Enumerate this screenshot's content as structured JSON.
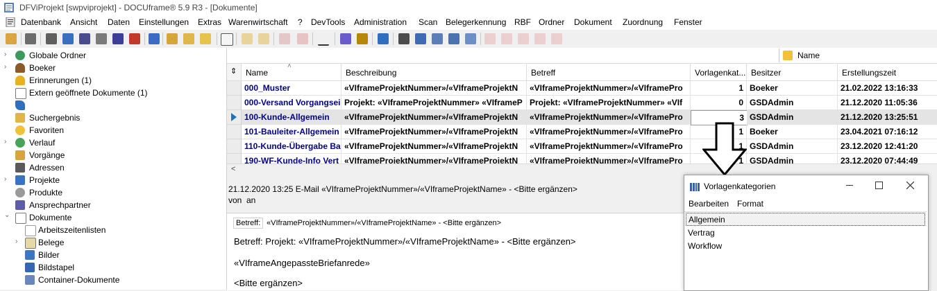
{
  "window": {
    "title": "DFViProjekt [swpviprojekt] - DOCUframe® 5.9 R3 - [Dokumente]"
  },
  "menu": [
    "Datenbank",
    "Ansicht",
    "Daten",
    "Einstellungen",
    "Extras",
    "Warenwirtschaft",
    "?",
    "DevTools",
    "Administration",
    "Scan",
    "Belegerkennung",
    "RBF",
    "Ordner",
    "Dokument",
    "Zuordnung",
    "Fenster"
  ],
  "tree": [
    {
      "label": "Globale Ordner",
      "icon": "globe-icon",
      "expandable": true
    },
    {
      "label": "Boeker",
      "icon": "user-icon",
      "expandable": true
    },
    {
      "label": "Erinnerungen (1)",
      "icon": "bell-icon",
      "expandable": false
    },
    {
      "label": "Extern geöffnete Dokumente (1)",
      "icon": "document-icon",
      "expandable": false
    },
    {
      "label": "",
      "icon": "pin-icon",
      "expandable": false
    },
    {
      "label": "Suchergebnis",
      "icon": "search-folder-icon",
      "expandable": false
    },
    {
      "label": "Favoriten",
      "icon": "star-icon",
      "expandable": false
    },
    {
      "label": "Verlauf",
      "icon": "history-icon",
      "expandable": true
    },
    {
      "label": "Vorgänge",
      "icon": "folder-icon",
      "expandable": false
    },
    {
      "label": "Adressen",
      "icon": "address-book-icon",
      "expandable": false
    },
    {
      "label": "Projekte",
      "icon": "project-icon",
      "expandable": true
    },
    {
      "label": "Produkte",
      "icon": "product-icon",
      "expandable": false
    },
    {
      "label": "Ansprechpartner",
      "icon": "contacts-icon",
      "expandable": false
    },
    {
      "label": "Dokumente",
      "icon": "document-icon",
      "expandable": true,
      "expanded": true
    },
    {
      "label": "Arbeitszeitenlisten",
      "icon": "document-icon",
      "expandable": false,
      "child": true
    },
    {
      "label": "Belege",
      "icon": "receipt-icon",
      "expandable": true,
      "child": true
    },
    {
      "label": "Bilder",
      "icon": "image-icon",
      "expandable": false,
      "child": true
    },
    {
      "label": "Bildstapel",
      "icon": "image-stack-icon",
      "expandable": false,
      "child": true
    },
    {
      "label": "Container-Dokumente",
      "icon": "container-icon",
      "expandable": false,
      "child": true
    }
  ],
  "filter": {
    "name_label": "Name"
  },
  "grid": {
    "columns": [
      "Name",
      "Beschreibung",
      "Betreff",
      "Vorlagenkat...",
      "Besitzer",
      "Erstellungszeit"
    ],
    "rows": [
      [
        "000_Muster",
        "«VIframeProjektNummer»/«VIframeProjektN",
        "«VIframeProjektNummer»/«VIframePro",
        "1",
        "Boeker",
        "21.02.2022 13:16:33"
      ],
      [
        "000-Versand Vorgangsei",
        "Projekt: «VIframeProjektNummer» «VIframeP",
        "Projekt: «VIframeProjektNummer» «VIf",
        "0",
        "GSDAdmin",
        "21.12.2020 11:05:36"
      ],
      [
        "100-Kunde-Allgemein",
        "«VIframeProjektNummer»/«VIframeProjektN",
        "«VIframeProjektNummer»/«VIframePro",
        "3",
        "GSDAdmin",
        "21.12.2020 13:25:51"
      ],
      [
        "101-Bauleiter-Allgemein",
        "«VIframeProjektNummer»/«VIframeProjektN",
        "«VIframeProjektNummer»/«VIframePro",
        "1",
        "Boeker",
        "23.04.2021 07:16:12"
      ],
      [
        "110-Kunde-Übergabe Ba",
        "«VIframeProjektNummer»/«VIframeProjektN",
        "«VIframeProjektNummer»/«VIframePro",
        "1",
        "GSDAdmin",
        "23.12.2020 12:41:20"
      ],
      [
        "190-WF-Kunde-Info Vert",
        "«VIframeProjektNummer»/«VIframeProjektN",
        "«VIframeProjektNummer»/«VIframePro",
        "1",
        "GSDAdmin",
        "23.12.2020 07:44:49"
      ]
    ],
    "selected_row": 2
  },
  "preview": {
    "header_line": "21.12.2020 13:25 E-Mail «VIframeProjektNummer»/«VIframeProjektName» - <Bitte ergänzen>",
    "from_label": "von",
    "to_label": "an",
    "subject_label": "Betreff:",
    "subject_value": "«VIframeProjektNummer»/«VIframeProjektName» - <Bitte ergänzen>",
    "body_lines": [
      "Betreff: Projekt: «VIframeProjektNummer»/«VIframeProjektName» - <Bitte ergänzen>",
      "«VIframeAngepassteBriefanrede»",
      "<Bitte ergänzen>"
    ]
  },
  "vorlagenkategorien": {
    "title": "Vorlagenkategorien",
    "menu": [
      "Bearbeiten",
      "Format"
    ],
    "items": [
      "Allgemein",
      "Vertrag",
      "Workflow"
    ],
    "selected_index": 0
  },
  "colors": {
    "link_blue": "#00008b",
    "selected_row": "#e4e4e4",
    "arrow_blue": "#1e73be"
  }
}
